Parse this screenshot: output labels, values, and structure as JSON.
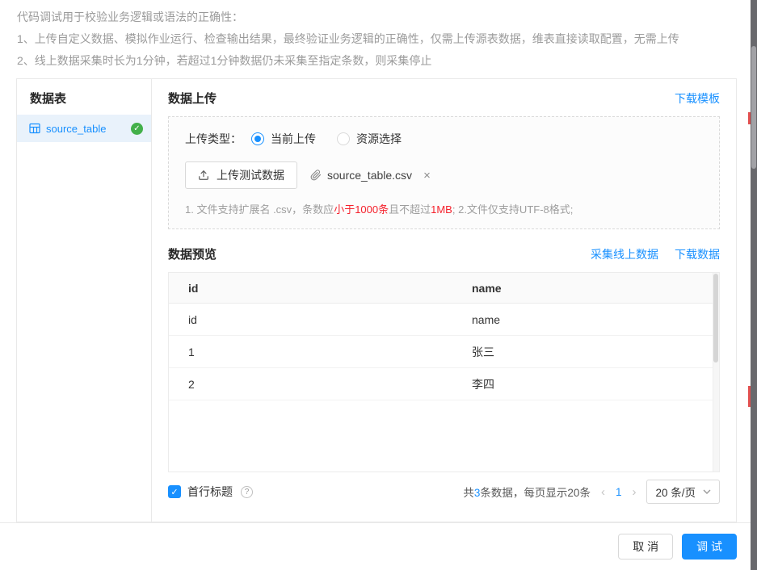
{
  "intro": {
    "line1": "代码调试用于校验业务逻辑或语法的正确性：",
    "line2": "1、上传自定义数据、模拟作业运行、检查输出结果，最终验证业务逻辑的正确性，仅需上传源表数据，维表直接读取配置，无需上传",
    "line3": "2、线上数据采集时长为1分钟，若超过1分钟数据仍未采集至指定条数，则采集停止"
  },
  "sidebar": {
    "title": "数据表",
    "items": [
      {
        "label": "source_table",
        "status": "success"
      }
    ]
  },
  "upload": {
    "title": "数据上传",
    "download_template_link": "下载模板",
    "type_label": "上传类型：",
    "options": [
      {
        "label": "当前上传",
        "selected": true
      },
      {
        "label": "资源选择",
        "selected": false
      }
    ],
    "upload_button_label": "上传测试数据",
    "file_name": "source_table.csv",
    "hint": {
      "p1": "1. 文件支持扩展名 .csv，条数应",
      "red1": "小于1000条",
      "p2": "且不超过",
      "red2": "1MB",
      "p3": "; 2.文件仅支持UTF-8格式;"
    }
  },
  "preview": {
    "title": "数据预览",
    "collect_link": "采集线上数据",
    "download_link": "下载数据",
    "header": [
      "id",
      "name"
    ],
    "rows": [
      [
        "id",
        "name"
      ],
      [
        "1",
        "张三"
      ],
      [
        "2",
        "李四"
      ]
    ],
    "first_row_title_label": "首行标题",
    "pagination": {
      "total_prefix": "共",
      "total_count": "3",
      "total_suffix": "条数据，每页显示20条",
      "current_page": "1",
      "page_size": "20 条/页"
    }
  },
  "footer": {
    "cancel_label": "取 消",
    "debug_label": "调 试"
  },
  "icons": {
    "close": "×",
    "prev": "‹",
    "next": "›",
    "help": "?",
    "check": "✓"
  },
  "colors": {
    "accent": "#1890ff",
    "success": "#43b04a",
    "danger": "#f5222d"
  }
}
